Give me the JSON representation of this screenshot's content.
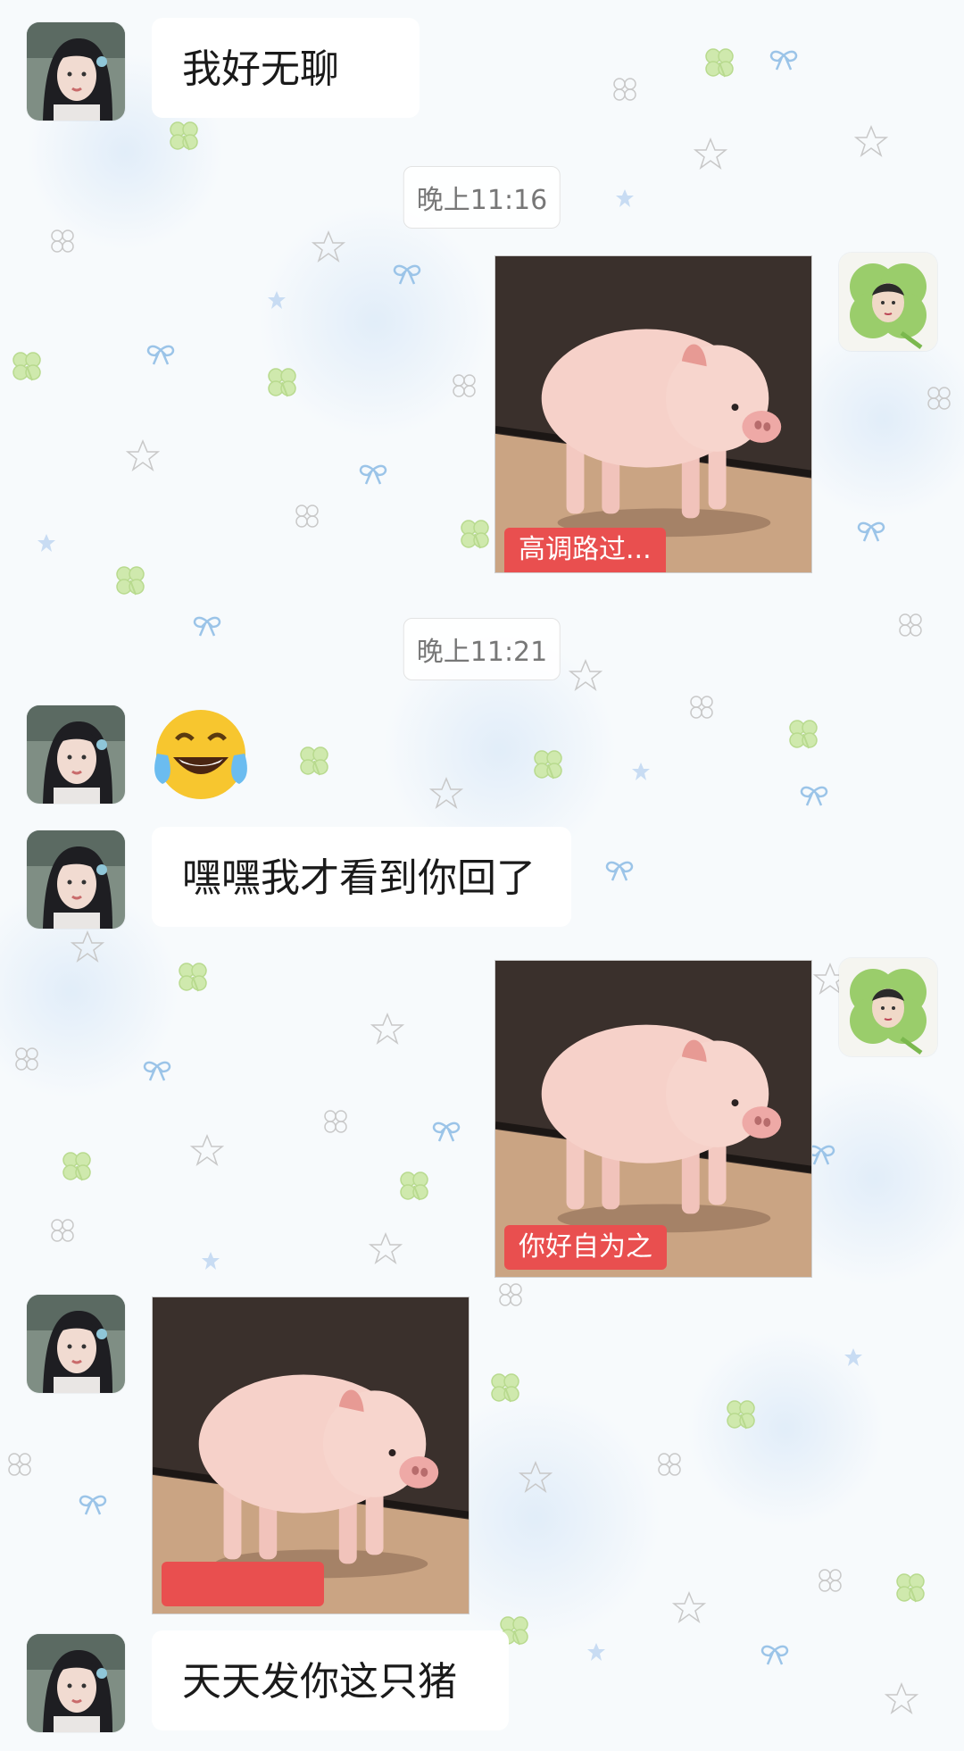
{
  "messages": {
    "m1": {
      "text": "我好无聊"
    },
    "t1": {
      "text": "晚上11:16"
    },
    "s1": {
      "caption": "高调路过..."
    },
    "t2": {
      "text": "晚上11:21"
    },
    "e1": {
      "emoji": "laughing-crying-emoji"
    },
    "m2": {
      "text": "嘿嘿我才看到你回了"
    },
    "s2": {
      "caption": "你好自为之"
    },
    "s3": {
      "caption": ""
    },
    "m3": {
      "text": "天天发你这只猪"
    }
  },
  "colors": {
    "caption_red": "#e94f4f",
    "clover_green": "#c6e6a0",
    "ribbon_blue": "#9bc4e8"
  }
}
